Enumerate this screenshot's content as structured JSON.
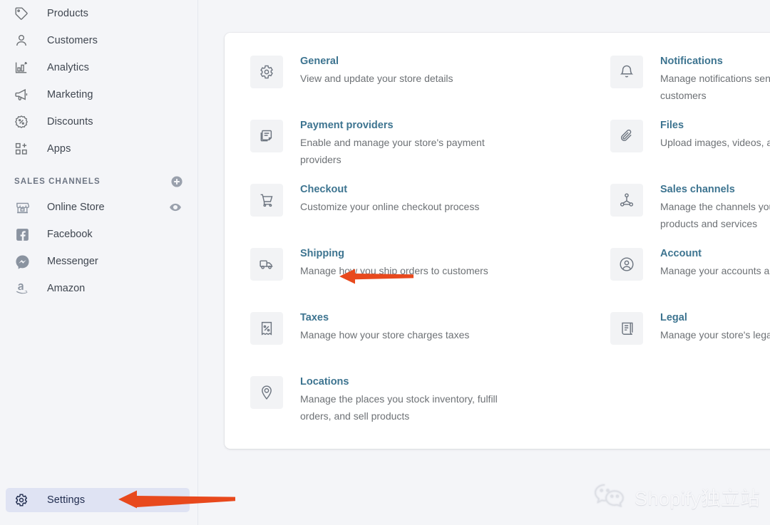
{
  "colors": {
    "accent_link": "#3d7490",
    "arrow": "#e8491d",
    "page_bg": "#f4f5f8",
    "active_pill": "#dfe3f3"
  },
  "sidebar": {
    "nav_items": [
      {
        "label": "Products",
        "icon": "tag-icon"
      },
      {
        "label": "Customers",
        "icon": "person-icon"
      },
      {
        "label": "Analytics",
        "icon": "bar-chart-icon"
      },
      {
        "label": "Marketing",
        "icon": "megaphone-icon"
      },
      {
        "label": "Discounts",
        "icon": "discount-percent-icon"
      },
      {
        "label": "Apps",
        "icon": "apps-grid-plus-icon"
      }
    ],
    "sales_channels": {
      "title": "SALES CHANNELS",
      "add_icon": "circle-plus-icon",
      "items": [
        {
          "label": "Online Store",
          "icon": "storefront-icon",
          "trailing_icon": "eye-icon"
        },
        {
          "label": "Facebook",
          "icon": "facebook-icon",
          "trailing_icon": ""
        },
        {
          "label": "Messenger",
          "icon": "messenger-icon",
          "trailing_icon": ""
        },
        {
          "label": "Amazon",
          "icon": "amazon-icon",
          "trailing_icon": ""
        }
      ]
    },
    "settings": {
      "label": "Settings",
      "icon": "gear-icon",
      "active": true
    }
  },
  "settings_panel": {
    "left_column": [
      {
        "title": "General",
        "desc": "View and update your store details",
        "icon": "gear-icon"
      },
      {
        "title": "Payment providers",
        "desc": "Enable and manage your store's payment providers",
        "icon": "payment-card-icon"
      },
      {
        "title": "Checkout",
        "desc": "Customize your online checkout process",
        "icon": "shopping-cart-icon"
      },
      {
        "title": "Shipping",
        "desc": "Manage how you ship orders to customers",
        "icon": "delivery-truck-icon"
      },
      {
        "title": "Taxes",
        "desc": "Manage how your store charges taxes",
        "icon": "tax-receipt-icon"
      },
      {
        "title": "Locations",
        "desc": "Manage the places you stock inventory, fulfill orders, and sell products",
        "icon": "location-pin-icon"
      }
    ],
    "right_column": [
      {
        "title": "Notifications",
        "desc": "Manage notifications sent to you and your customers",
        "icon": "bell-icon"
      },
      {
        "title": "Files",
        "desc": "Upload images, videos, and documents",
        "icon": "paperclip-icon"
      },
      {
        "title": "Sales channels",
        "desc": "Manage the channels you use to sell your products and services",
        "icon": "channels-network-icon"
      },
      {
        "title": "Account",
        "desc": "Manage your accounts and permissions",
        "icon": "account-circle-icon"
      },
      {
        "title": "Legal",
        "desc": "Manage your store's legal pages",
        "icon": "legal-scroll-icon"
      }
    ]
  },
  "annotations": [
    {
      "name": "arrow-pointing-to-shipping",
      "points_to": "Shipping",
      "direction": "left"
    },
    {
      "name": "arrow-pointing-to-settings",
      "points_to": "Settings",
      "direction": "left"
    }
  ],
  "watermark": {
    "text": "Shopify独立站",
    "icon": "wechat-icon"
  }
}
